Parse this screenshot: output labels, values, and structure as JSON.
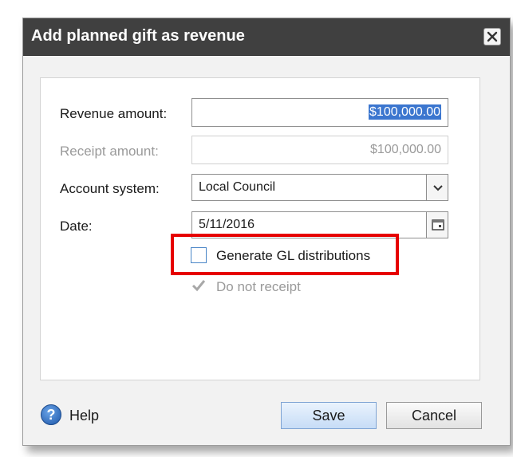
{
  "dialog": {
    "title": "Add planned gift as revenue",
    "close_icon": "close-icon"
  },
  "form": {
    "revenue_amount": {
      "label": "Revenue amount:",
      "value": "$100,000.00"
    },
    "receipt_amount": {
      "label": "Receipt amount:",
      "value": "$100,000.00"
    },
    "account_system": {
      "label": "Account system:",
      "value": "Local Council"
    },
    "date": {
      "label": "Date:",
      "value": "5/11/2016"
    },
    "generate_gl": {
      "label": "Generate GL distributions",
      "checked": false
    },
    "do_not_receipt": {
      "label": "Do not receipt",
      "checked": true,
      "disabled": true
    }
  },
  "footer": {
    "help_label": "Help",
    "save_label": "Save",
    "cancel_label": "Cancel"
  },
  "colors": {
    "titlebar": "#404040",
    "highlight": "#e60000",
    "selection": "#3b76cf"
  }
}
